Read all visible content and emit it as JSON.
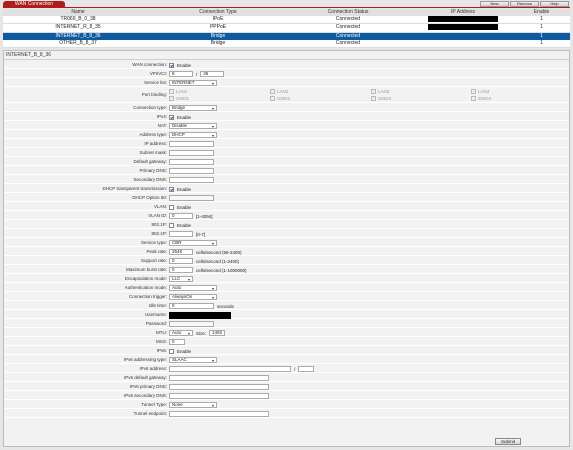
{
  "header": {
    "title": "WAN Connection",
    "buttons": [
      "New",
      "Remove",
      "Help"
    ]
  },
  "table": {
    "columns": [
      "Name",
      "Connection Type",
      "Connection Status",
      "IP Address",
      "Enable"
    ],
    "rows": [
      {
        "name": "TR069_B_0_38",
        "type": "IPoE",
        "status": "Connected",
        "enable": "1"
      },
      {
        "name": "INTERNET_R_8_35",
        "type": "PPPoE",
        "status": "Connected",
        "enable": "1"
      },
      {
        "name": "INTERNET_B_8_36",
        "type": "Bridge",
        "status": "Connected",
        "enable": "1"
      },
      {
        "name": "OTHER_B_8_37",
        "type": "Bridge",
        "status": "Connected",
        "enable": "1"
      }
    ]
  },
  "panel": {
    "title": "INTERNET_B_8_36",
    "wan_connection": {
      "label": "WAN connection:",
      "text": "Enable"
    },
    "vpi_vci": {
      "label": "VPI/VCI:",
      "vpi": "8",
      "sep": "/",
      "vci": "36"
    },
    "service_list": {
      "label": "Service list:",
      "value": "INTERNET"
    },
    "port_binding": {
      "label": "Port binding:",
      "ports": [
        "LAN1",
        "LAN2",
        "LAN3",
        "LAN4",
        "SSID1",
        "SSID2",
        "SSID3",
        "SSID4"
      ]
    },
    "connection_type": {
      "label": "Connection type:",
      "value": "Bridge"
    },
    "ipv4": {
      "label": "IPv4:",
      "text": "Enable"
    },
    "nat": {
      "label": "NAT:",
      "value": "Disable"
    },
    "address_type": {
      "label": "Address type:",
      "value": "DHCP"
    },
    "ip_address": {
      "label": "IP address:"
    },
    "subnet_mask": {
      "label": "Subnet mask:"
    },
    "default_gateway": {
      "label": "Default gateway:"
    },
    "primary_dns": {
      "label": "Primary DNS:"
    },
    "secondary_dns": {
      "label": "Secondary DNS:"
    },
    "dhcp_transparent": {
      "label": "DHCP transparent transmission:",
      "text": "Enable"
    },
    "dhcp_option60": {
      "label": "DHCP Option 60:"
    },
    "vlan": {
      "label": "VLAN:",
      "text": "Enable"
    },
    "vlan_id": {
      "label": "VLAN ID:",
      "value": "0",
      "hint": "[1-4094]"
    },
    "p8021p": {
      "label": "802.1P:",
      "text": "Enable"
    },
    "p8021p_value": {
      "label": "802.1P:",
      "hint": "[0-7]"
    },
    "service_type": {
      "label": "Service type:",
      "value": "CBR"
    },
    "peak_rate": {
      "label": "Peak rate:",
      "value": "2648",
      "hint": "cells/second (56-2400)"
    },
    "support_rate": {
      "label": "Support rate:",
      "value": "0",
      "hint": "cells/second (1-2400)"
    },
    "max_burst": {
      "label": "Maximum burst rate:",
      "value": "0",
      "hint": "cells/second (1-1000000)"
    },
    "encapsulation": {
      "label": "Encapsulation mode:",
      "value": "LLC"
    },
    "auth_mode": {
      "label": "Authentication mode:",
      "value": "Auto"
    },
    "conn_trigger": {
      "label": "Connection trigger:",
      "value": "AlwaysOn"
    },
    "idle_time": {
      "label": "Idle time:",
      "value": "0",
      "hint": "seconds"
    },
    "username": {
      "label": "Username:"
    },
    "password": {
      "label": "Password:"
    },
    "mtu": {
      "label": "MTU:",
      "value": "Auto",
      "size_label": "Size:",
      "size": "1492"
    },
    "mss": {
      "label": "MSS:",
      "value": "0"
    },
    "ipv6": {
      "label": "IPv6:",
      "text": "Enable"
    },
    "ipv6_addr_type": {
      "label": "IPv6 addressing type:",
      "value": "SLAAC"
    },
    "ipv6_address": {
      "label": "IPv6 address:",
      "sep": "/"
    },
    "ipv6_gateway": {
      "label": "IPv6 default gateway:"
    },
    "ipv6_primary_dns": {
      "label": "IPv6 primary DNS:"
    },
    "ipv6_secondary_dns": {
      "label": "IPv6 secondary DNS:"
    },
    "tunnel_type": {
      "label": "Tunnel Type:",
      "value": "None"
    },
    "tunnel_endpoint": {
      "label": "Tunnel endpoint:"
    },
    "submit": "Submit"
  }
}
